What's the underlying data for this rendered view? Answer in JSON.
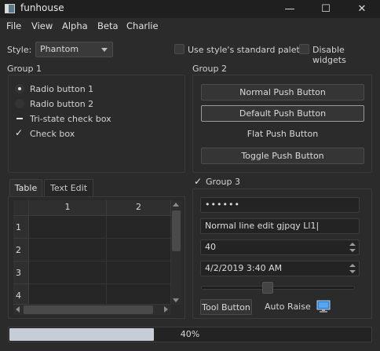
{
  "window": {
    "title": "funhouse",
    "controls": [
      "—",
      "☐",
      "✕"
    ]
  },
  "menu": {
    "items": [
      "File",
      "View",
      "Alpha",
      "Beta",
      "Charlie"
    ]
  },
  "style": {
    "label": "Style:",
    "value": "Phantom"
  },
  "options": {
    "standard_palette": "Use style's standard palette",
    "disable_widgets": "Disable widgets"
  },
  "group1": {
    "title": "Group 1",
    "radio1": "Radio button 1",
    "radio2": "Radio button 2",
    "tristate": "Tri-state check box",
    "checkbox": "Check box"
  },
  "group2": {
    "title": "Group 2",
    "normal": "Normal Push Button",
    "default": "Default Push Button",
    "flat": "Flat Push Button",
    "toggle": "Toggle Push Button"
  },
  "tabs": {
    "table": "Table",
    "text_edit": "Text Edit"
  },
  "table": {
    "columns": [
      "1",
      "2"
    ],
    "rows": [
      "1",
      "2",
      "3",
      "4"
    ]
  },
  "group3": {
    "title": "Group 3",
    "password": "••••••",
    "line_edit": "Normal line edit gjpqy Ll1|",
    "spin_value": "40",
    "datetime": "4/2/2019 3:40 AM",
    "slider_value": 0.43,
    "tool_button": "Tool Button",
    "auto_raise": "Auto Raise",
    "monitor_icon": "monitor-icon"
  },
  "progress": {
    "value": 40,
    "text": "40%"
  },
  "colors": {
    "background": "#2b2b2b",
    "progress_fill": "#c6cdd6",
    "default_button_border": "#9a9a9a"
  }
}
